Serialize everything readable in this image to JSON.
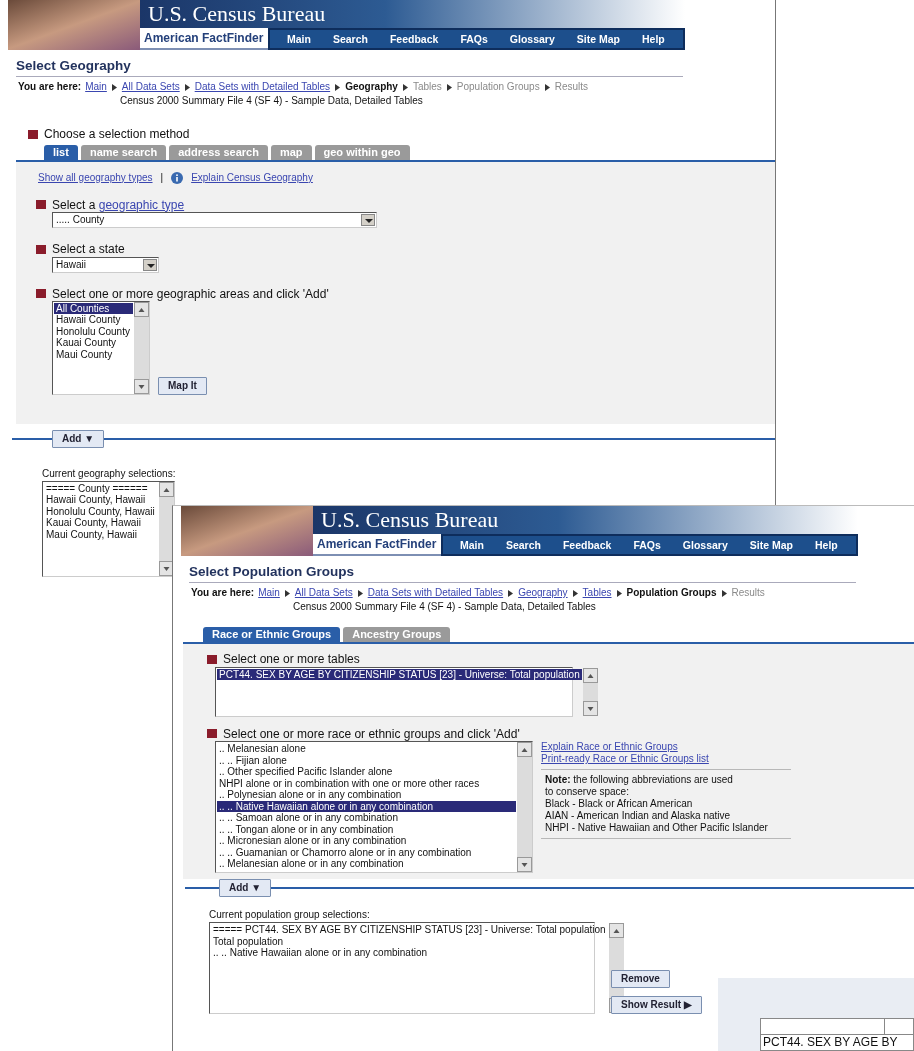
{
  "screens": [
    {
      "kind": "geography",
      "header": {
        "bureau": "U.S. Census Bureau",
        "product": "American FactFinder",
        "nav": [
          "Main",
          "Search",
          "Feedback",
          "FAQs",
          "Glossary",
          "Site Map",
          "Help"
        ]
      },
      "page_title": "Select Geography",
      "breadcrumb": {
        "label": "You are here:",
        "steps": [
          {
            "text": "Main",
            "kind": "link"
          },
          {
            "text": "All Data Sets",
            "kind": "link"
          },
          {
            "text": "Data Sets with Detailed Tables",
            "kind": "link"
          },
          {
            "text": "Geography",
            "kind": "current"
          },
          {
            "text": "Tables",
            "kind": "future"
          },
          {
            "text": "Population Groups",
            "kind": "future"
          },
          {
            "text": "Results",
            "kind": "future"
          }
        ]
      },
      "dataset": "Census 2000 Summary File 4 (SF 4) - Sample Data, Detailed Tables",
      "method_heading": "Choose a selection method",
      "tabs": [
        {
          "label": "list",
          "selected": true
        },
        {
          "label": "name search",
          "selected": false
        },
        {
          "label": "address search",
          "selected": false
        },
        {
          "label": "map",
          "selected": false
        },
        {
          "label": "geo within geo",
          "selected": false
        }
      ],
      "links": {
        "show_all": "Show all geography types",
        "separator": "|",
        "explain": "Explain Census Geography"
      },
      "geo_type": {
        "prompt": "Select a",
        "link": "geographic type",
        "value": "..... County"
      },
      "state": {
        "prompt": "Select a state",
        "value": "Hawaii"
      },
      "areas": {
        "prompt": "Select one or more geographic areas and click 'Add'",
        "items": [
          {
            "text": "All Counties",
            "selected": true
          },
          {
            "text": "Hawaii County",
            "selected": false
          },
          {
            "text": "Honolulu County",
            "selected": false
          },
          {
            "text": "Kauai County",
            "selected": false
          },
          {
            "text": "Maui County",
            "selected": false
          }
        ],
        "button": "Map It"
      },
      "add_button": "Add ▼",
      "current": {
        "label": "Current geography selections:",
        "lines": [
          "===== County ======",
          "Hawaii County, Hawaii",
          "Honolulu County, Hawaii",
          "Kauai County, Hawaii",
          "Maui County, Hawaii"
        ]
      }
    },
    {
      "kind": "population",
      "header": {
        "bureau": "U.S. Census Bureau",
        "product": "American FactFinder",
        "nav": [
          "Main",
          "Search",
          "Feedback",
          "FAQs",
          "Glossary",
          "Site Map",
          "Help"
        ]
      },
      "page_title": "Select Population Groups",
      "breadcrumb": {
        "label": "You are here:",
        "steps": [
          {
            "text": "Main",
            "kind": "link"
          },
          {
            "text": "All Data Sets",
            "kind": "link"
          },
          {
            "text": "Data Sets with Detailed Tables",
            "kind": "link"
          },
          {
            "text": "Geography",
            "kind": "link"
          },
          {
            "text": "Tables",
            "kind": "link"
          },
          {
            "text": "Population Groups",
            "kind": "current"
          },
          {
            "text": "Results",
            "kind": "future"
          }
        ]
      },
      "dataset": "Census 2000 Summary File 4 (SF 4) - Sample Data, Detailed Tables",
      "tabs": [
        {
          "label": "Race or Ethnic Groups",
          "selected": true
        },
        {
          "label": "Ancestry Groups",
          "selected": false
        }
      ],
      "tables": {
        "prompt": "Select one or more tables",
        "items": [
          {
            "text": "PCT44. SEX BY AGE BY CITIZENSHIP STATUS [23] - Universe: Total population",
            "selected": true
          }
        ]
      },
      "groups": {
        "prompt": "Select one or more race or ethnic groups and click 'Add'",
        "items": [
          {
            "text": ".. Melanesian alone",
            "selected": false
          },
          {
            "text": ".. .. Fijian alone",
            "selected": false
          },
          {
            "text": ".. Other specified Pacific Islander alone",
            "selected": false
          },
          {
            "text": "NHPI alone or in combination with one or more other races",
            "selected": false
          },
          {
            "text": ".. Polynesian alone or in any combination",
            "selected": false
          },
          {
            "text": ".. .. Native Hawaiian alone or in any combination",
            "selected": true
          },
          {
            "text": ".. .. Samoan alone or in any combination",
            "selected": false
          },
          {
            "text": ".. .. Tongan alone or in any combination",
            "selected": false
          },
          {
            "text": ".. Micronesian alone or in any combination",
            "selected": false
          },
          {
            "text": ".. .. Guamanian or Chamorro alone or in any combination",
            "selected": false
          },
          {
            "text": ".. Melanesian alone or in any combination",
            "selected": false
          }
        ]
      },
      "side_links": [
        "Explain Race or Ethnic Groups",
        "Print-ready Race or Ethnic Groups list"
      ],
      "note": {
        "intro": "**Note:** the following abbreviations are used to conserve space:",
        "lines": [
          "Black - Black or African American",
          "AIAN - American Indian and Alaska native",
          "NHPI - Native Hawaiian and Other Pacific Islander"
        ]
      },
      "add_button": "Add ▼",
      "current": {
        "label": "Current population group selections:",
        "lines": [
          "===== PCT44. SEX BY AGE BY CITIZENSHIP STATUS [23] - Universe: Total population",
          "Total population",
          ".. .. Native Hawaiian alone or in any combination"
        ]
      },
      "remove_button": "Remove",
      "show_button": "Show Result ▶"
    },
    {
      "kind": "results",
      "table_cell": "PCT44. SEX BY AGE BY"
    }
  ]
}
